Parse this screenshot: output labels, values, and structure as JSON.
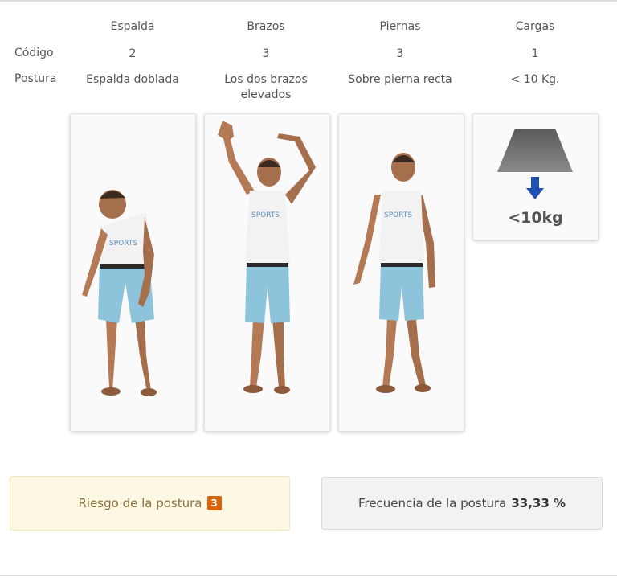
{
  "columns": [
    "Espalda",
    "Brazos",
    "Piernas",
    "Cargas"
  ],
  "rows": {
    "codigo": {
      "label": "Código",
      "values": [
        "2",
        "3",
        "3",
        "1"
      ]
    },
    "postura": {
      "label": "Postura",
      "values": [
        "Espalda doblada",
        "Los dos brazos elevados",
        "Sobre pierna recta",
        "< 10 Kg."
      ]
    }
  },
  "cards": [
    {
      "icon": "figure-back-bent"
    },
    {
      "icon": "figure-arms-raised"
    },
    {
      "icon": "figure-standing"
    },
    {
      "icon": "weight-load-icon",
      "label": "<10kg"
    }
  ],
  "risk": {
    "label": "Riesgo de la postura",
    "value": "3",
    "color": "#d9660a"
  },
  "frequency": {
    "label": "Frecuencia de la postura",
    "value": "33,33 %"
  },
  "colors": {
    "skin": "#b47a56",
    "shirt": "#f2f2f2",
    "shorts": "#8ec3dc",
    "arrow": "#1f4fb0",
    "weight": "#6c6c6c"
  }
}
